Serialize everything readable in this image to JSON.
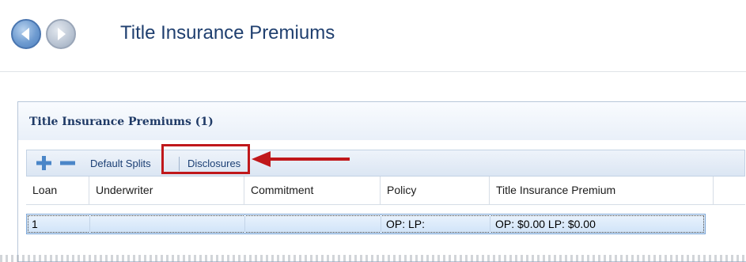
{
  "header": {
    "title": "Title Insurance Premiums",
    "back_icon": "back-arrow-icon",
    "forward_icon": "forward-arrow-icon"
  },
  "panel": {
    "title": "Title Insurance Premiums (1)"
  },
  "toolbar": {
    "add_icon": "plus-icon",
    "remove_icon": "minus-icon",
    "default_splits_label": "Default Splits",
    "disclosures_label": "Disclosures"
  },
  "annotation": {
    "highlight_color": "#c0181b"
  },
  "table": {
    "columns": [
      "Loan",
      "Underwriter",
      "Commitment",
      "Policy",
      "Title Insurance Premium"
    ],
    "rows": [
      {
        "loan": "1",
        "underwriter": "",
        "commitment": "",
        "policy": "OP:  LP:",
        "premium": "OP: $0.00 LP: $0.00"
      }
    ]
  },
  "colors": {
    "accent": "#1f3f6f",
    "selection": "#cfe3f8"
  }
}
